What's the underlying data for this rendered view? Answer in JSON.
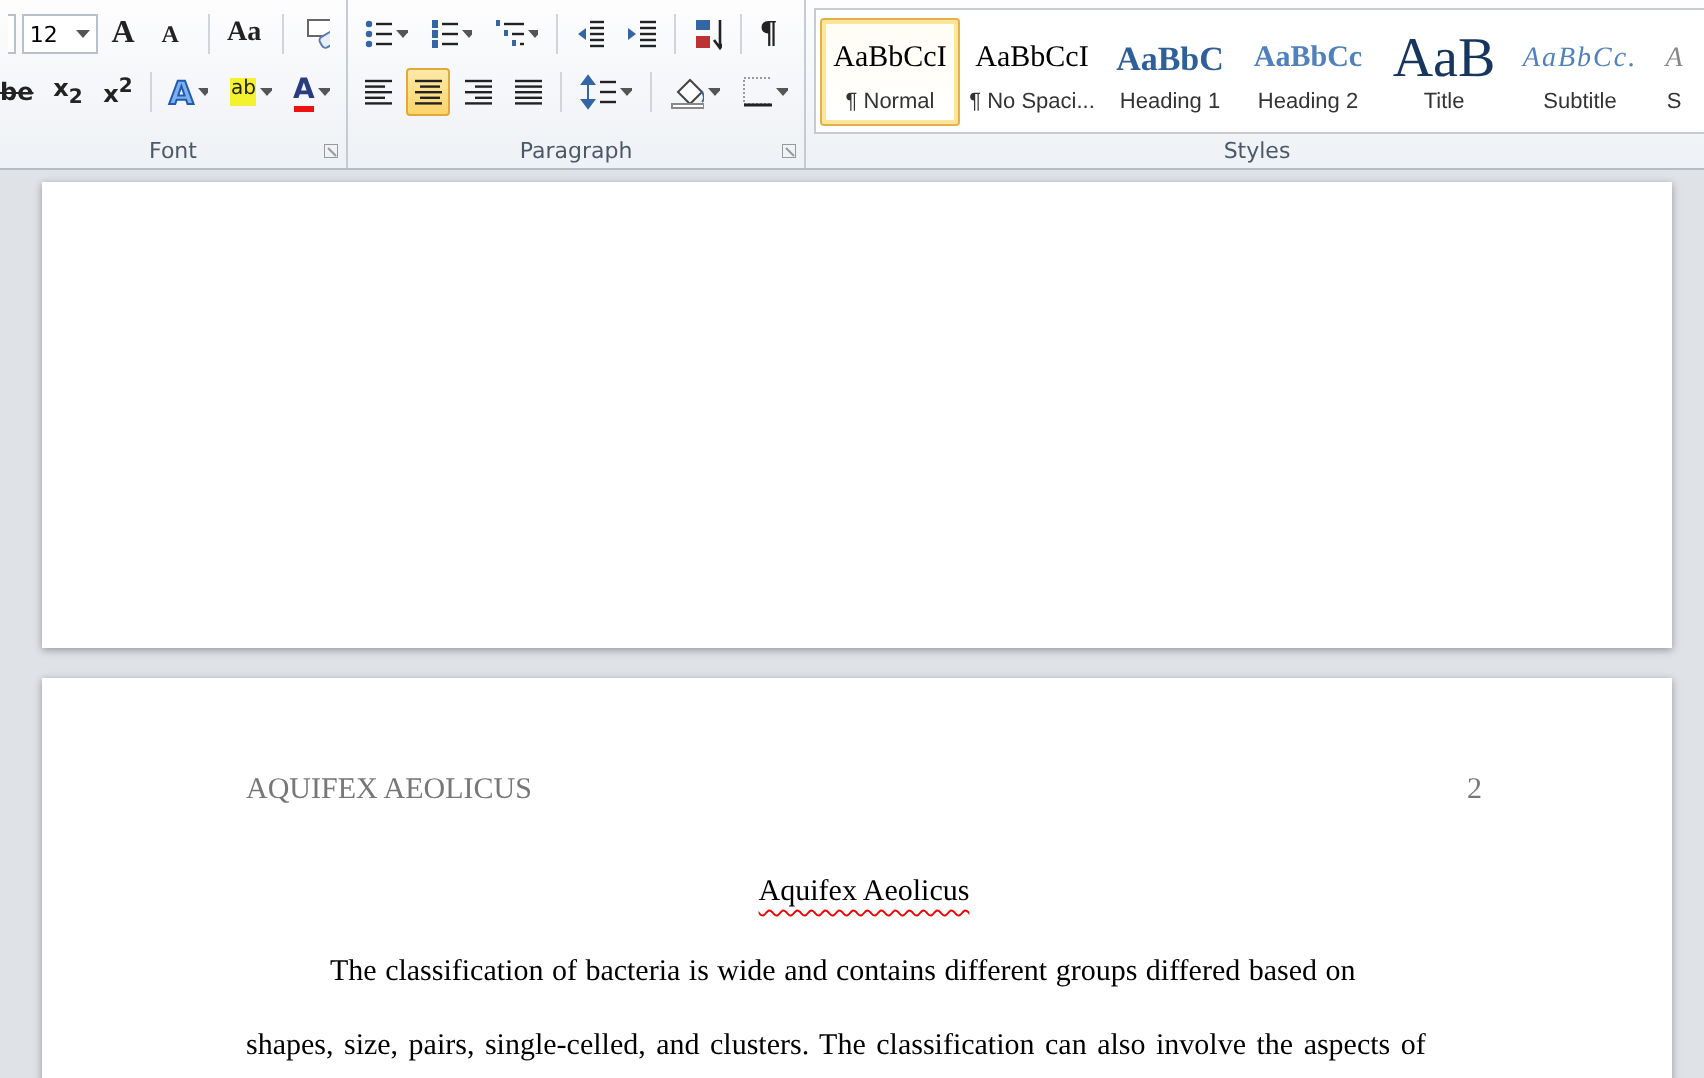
{
  "ribbon": {
    "font_group": {
      "label": "Font",
      "font_size": "12",
      "row1": [
        {
          "kind": "grow",
          "text": "A"
        },
        {
          "kind": "shrink",
          "text": "A"
        },
        {
          "kind": "case",
          "text": "Aa"
        },
        {
          "kind": "clear"
        }
      ],
      "row2": [
        {
          "kind": "strike",
          "text": "be"
        },
        {
          "kind": "sub",
          "text": "x$_{2}$"
        },
        {
          "kind": "sup",
          "text": "x$^{2}$"
        },
        {
          "kind": "effects",
          "text": "A"
        },
        {
          "kind": "highlight",
          "text": "ab"
        },
        {
          "kind": "color",
          "text": "A"
        }
      ]
    },
    "paragraph_group": {
      "label": "Paragraph",
      "row1": [
        {
          "kind": "bullets"
        },
        {
          "kind": "numbering"
        },
        {
          "kind": "multilevel"
        },
        {
          "kind": "outdent"
        },
        {
          "kind": "indent"
        },
        {
          "kind": "sort"
        },
        {
          "kind": "marks",
          "text": "¶"
        }
      ],
      "row2": [
        {
          "kind": "align_left",
          "selected": false
        },
        {
          "kind": "align_center",
          "selected": true
        },
        {
          "kind": "align_right",
          "selected": false
        },
        {
          "kind": "justify",
          "selected": false
        },
        {
          "kind": "spacing"
        },
        {
          "kind": "shading"
        },
        {
          "kind": "borders"
        }
      ]
    },
    "styles_group": {
      "label": "Styles",
      "styles": [
        {
          "kind": "normal",
          "preview": "AaBbCcI",
          "name": "¶ Normal",
          "selected": true
        },
        {
          "kind": "plain",
          "preview": "AaBbCcI",
          "name": "¶ No Spaci...",
          "selected": false
        },
        {
          "kind": "heading1",
          "preview": "AaBbC",
          "name": "Heading 1",
          "selected": false
        },
        {
          "kind": "heading2",
          "preview": "AaBbCc",
          "name": "Heading 2",
          "selected": false
        },
        {
          "kind": "title",
          "preview": "AaB",
          "name": "Title",
          "selected": false
        },
        {
          "kind": "subtitle",
          "preview": "AaBbCc.",
          "name": "Subtitle",
          "selected": false
        },
        {
          "kind": "subtle",
          "preview": "A",
          "name": "S",
          "selected": false
        }
      ]
    }
  },
  "document": {
    "page_2": {
      "header": "AQUIFEX AEOLICUS",
      "page_number": "2",
      "title": "Aquifex Aeolicus",
      "title_spelling_error": true,
      "paragraph_lines": [
        "The classification of bacteria is wide and contains different groups differed based on",
        "shapes, size, pairs, single-celled, and clusters. The classification can also involve the aspects of"
      ]
    }
  }
}
